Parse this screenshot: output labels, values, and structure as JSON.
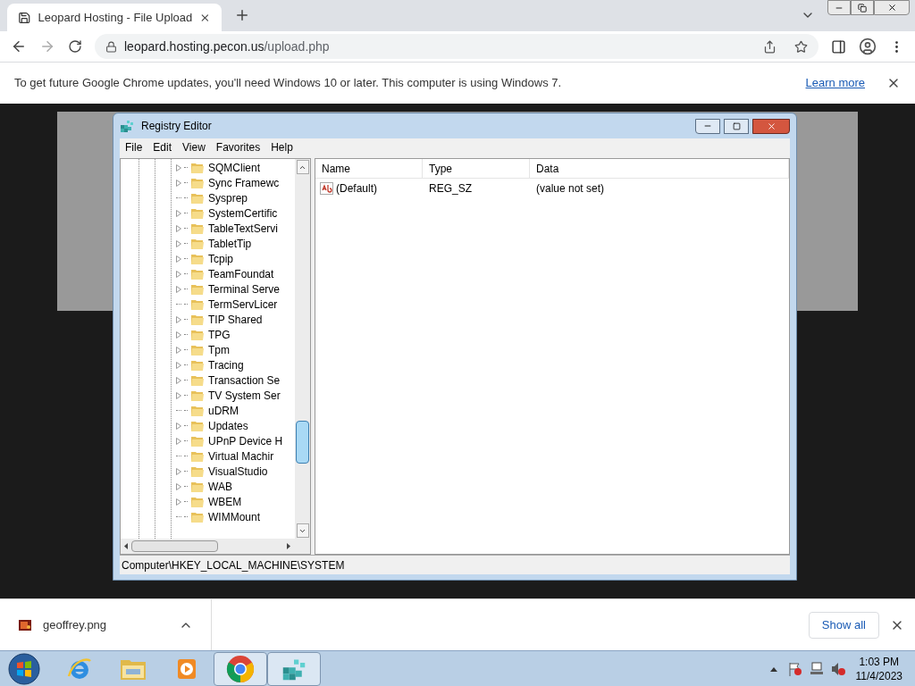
{
  "browser": {
    "tab": {
      "title": "Leopard Hosting - File Upload"
    },
    "url": {
      "host": "leopard.hosting.pecon.us",
      "path": "/upload.php"
    },
    "infobar": {
      "message": "To get future Google Chrome updates, you'll need Windows 10 or later. This computer is using Windows 7.",
      "link": "Learn more"
    }
  },
  "regedit": {
    "title": "Registry Editor",
    "menu": [
      "File",
      "Edit",
      "View",
      "Favorites",
      "Help"
    ],
    "tree": [
      {
        "label": "SQMClient",
        "expandable": true
      },
      {
        "label": "Sync Framewc",
        "expandable": true
      },
      {
        "label": "Sysprep",
        "expandable": false
      },
      {
        "label": "SystemCertific",
        "expandable": true
      },
      {
        "label": "TableTextServi",
        "expandable": true
      },
      {
        "label": "TabletTip",
        "expandable": true
      },
      {
        "label": "Tcpip",
        "expandable": true
      },
      {
        "label": "TeamFoundat",
        "expandable": true
      },
      {
        "label": "Terminal Serve",
        "expandable": true
      },
      {
        "label": "TermServLicer",
        "expandable": false
      },
      {
        "label": "TIP Shared",
        "expandable": true
      },
      {
        "label": "TPG",
        "expandable": true
      },
      {
        "label": "Tpm",
        "expandable": true
      },
      {
        "label": "Tracing",
        "expandable": true
      },
      {
        "label": "Transaction Se",
        "expandable": true
      },
      {
        "label": "TV System Ser",
        "expandable": true
      },
      {
        "label": "uDRM",
        "expandable": false
      },
      {
        "label": "Updates",
        "expandable": true
      },
      {
        "label": "UPnP Device H",
        "expandable": true
      },
      {
        "label": "Virtual Machir",
        "expandable": false
      },
      {
        "label": "VisualStudio",
        "expandable": true
      },
      {
        "label": "WAB",
        "expandable": true
      },
      {
        "label": "WBEM",
        "expandable": true
      },
      {
        "label": "WIMMount",
        "expandable": false
      }
    ],
    "columns": [
      "Name",
      "Type",
      "Data"
    ],
    "values": [
      {
        "name": "(Default)",
        "type": "REG_SZ",
        "data": "(value not set)"
      }
    ],
    "status_bar": "Computer\\HKEY_LOCAL_MACHINE\\SYSTEM"
  },
  "downloads": {
    "file": "geoffrey.png",
    "show_all": "Show all"
  },
  "taskbar": {
    "apps": [
      {
        "kind": "ie",
        "active": false
      },
      {
        "kind": "explorer",
        "active": false
      },
      {
        "kind": "media",
        "active": false
      },
      {
        "kind": "chrome",
        "active": true
      },
      {
        "kind": "regedit",
        "active": true
      }
    ],
    "time": "1:03 PM",
    "date": "11/4/2023"
  }
}
